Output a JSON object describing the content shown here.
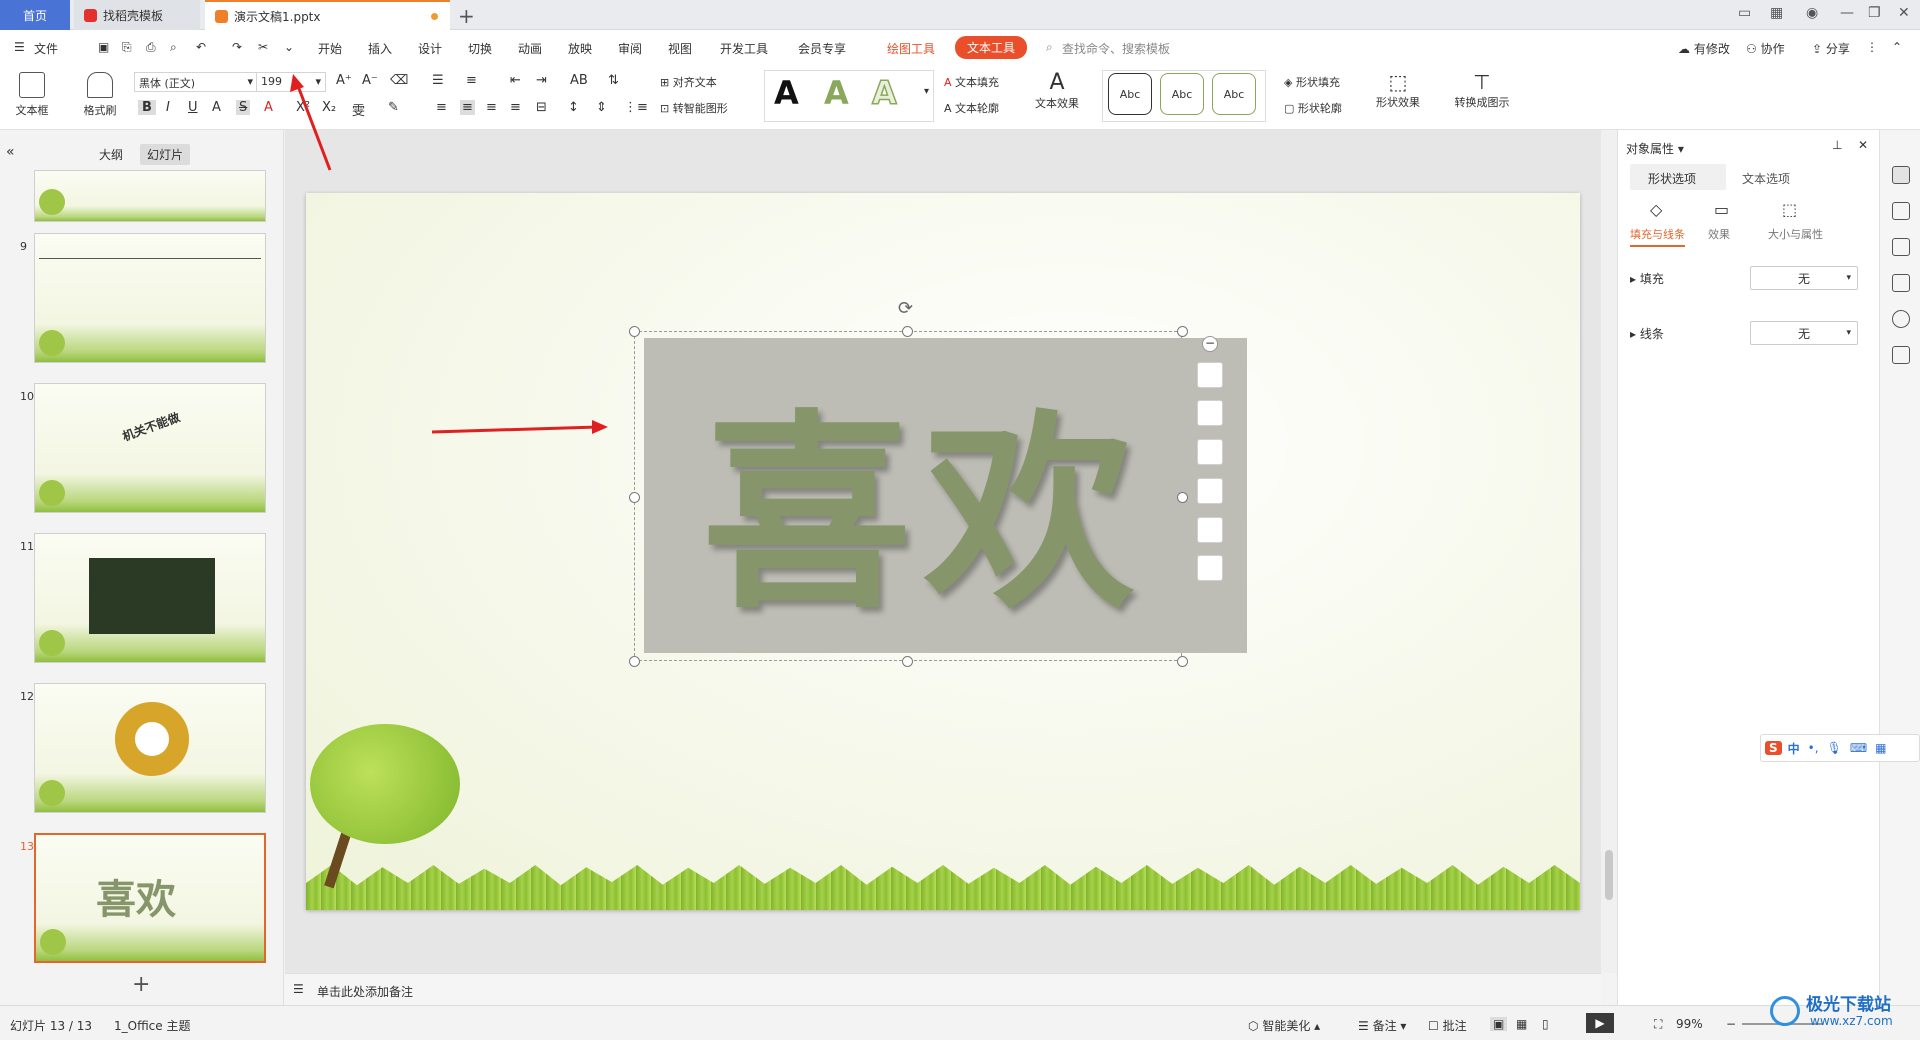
{
  "tabs": {
    "home": "首页",
    "template": "找稻壳模板",
    "document": "演示文稿1.pptx"
  },
  "menu": {
    "file": "文件",
    "items": [
      "开始",
      "插入",
      "设计",
      "切换",
      "动画",
      "放映",
      "审阅",
      "视图",
      "开发工具",
      "会员专享"
    ],
    "drawing_tools": "绘图工具",
    "text_tools": "文本工具",
    "search_placeholder": "查找命令、搜索模板",
    "has_changes": "有修改",
    "collaborate": "协作",
    "share": "分享"
  },
  "ribbon": {
    "textbox": "文本框",
    "format_painter": "格式刷",
    "font_name": "黑体 (正文)",
    "font_size": "199",
    "align_text": "对齐文本",
    "convert_smartart": "转智能图形",
    "text_fill": "文本填充",
    "text_outline": "文本轮廓",
    "text_effect": "文本效果",
    "abc_1": "Abc",
    "abc_2": "Abc",
    "abc_3": "Abc",
    "shape_fill": "形状填充",
    "shape_outline": "形状轮廓",
    "shape_effect": "形状效果",
    "convert_diagram": "转换成图示"
  },
  "leftpane": {
    "tab_outline": "大纲",
    "tab_slides": "幻灯片",
    "slide_numbers": [
      "9",
      "10",
      "11",
      "12",
      "13"
    ],
    "slide10_text": "机关不能做",
    "slide13_text": "喜欢",
    "add_slide": "+"
  },
  "slide": {
    "main_text": "喜欢"
  },
  "notes": {
    "placeholder": "单击此处添加备注"
  },
  "rightpane": {
    "title": "对象属性",
    "tab_shape": "形状选项",
    "tab_text": "文本选项",
    "sub_fill_line": "填充与线条",
    "sub_effect": "效果",
    "sub_size": "大小与属性",
    "fill_label": "填充",
    "fill_value": "无",
    "line_label": "线条",
    "line_value": "无"
  },
  "status": {
    "slide_counter": "幻灯片 13 / 13",
    "theme": "1_Office 主题",
    "smart_beautify": "智能美化",
    "notes": "备注",
    "comments": "批注",
    "zoom": "99%"
  },
  "ime": {
    "mode": "中"
  },
  "watermark": {
    "site": "极光下载站",
    "url": "www.xz7.com"
  },
  "colors": {
    "accent_orange": "#e94f2a",
    "tab_blue": "#4a73d6",
    "text_green": "#87966a",
    "arrow_red": "#e02020"
  }
}
